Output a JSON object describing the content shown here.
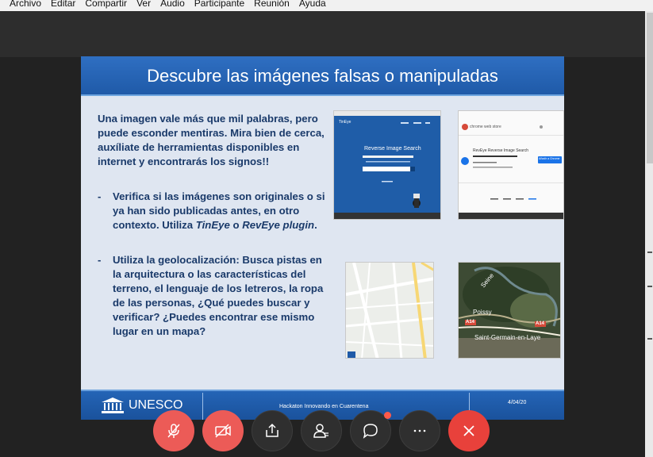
{
  "menu": [
    "Archivo",
    "Editar",
    "Compartir",
    "Ver",
    "Audio",
    "Participante",
    "Reunión",
    "Ayuda"
  ],
  "slide": {
    "title": "Descubre las imágenes falsas o manipuladas",
    "intro": "Una imagen vale más que mil palabras, pero puede esconder mentiras. Mira bien de cerca, auxíliate de herramientas disponibles en internet y encontrarás los signos!!",
    "bullet1_pre": "Verifica si las imágenes son originales o si ya han sido publicadas antes, en otro contexto. Utiliza ",
    "bullet1_tool1": "TinEye",
    "bullet1_mid": " o ",
    "bullet1_tool2": "RevEye plugin",
    "bullet1_post": ".",
    "bullet2": "Utiliza la geolocalización: Busca pistas en la arquitectura o las características del terreno, el lenguaje de los letreros, la ropa de las personas, ¿Qué puedes buscar y verificar? ¿Puedes encontrar ese mismo lugar en un mapa?",
    "dash": "-",
    "thumb_tineye": {
      "logo": "TinEye",
      "heading": "Reverse Image Search"
    },
    "thumb_reveye": {
      "store": "chrome web store",
      "name": "RevEye Reverse Image Search",
      "button": "Añadir a Chrome"
    },
    "thumb_satellite": {
      "label_seine": "Seine",
      "label_poissy": "Poissy",
      "label_city": "Saint-Germain-en-Laye",
      "road1": "A14",
      "road2": "A14"
    },
    "footer": {
      "org": "UNESCO",
      "event": "Hackaton Innovando en Cuarentena",
      "date": "4/04/20"
    }
  },
  "controls": [
    {
      "name": "mute-button",
      "icon": "mic-off-icon"
    },
    {
      "name": "video-button",
      "icon": "video-off-icon"
    },
    {
      "name": "share-button",
      "icon": "share-icon"
    },
    {
      "name": "participants-button",
      "icon": "participants-icon"
    },
    {
      "name": "chat-button",
      "icon": "chat-icon"
    },
    {
      "name": "more-button",
      "icon": "more-icon"
    },
    {
      "name": "leave-button",
      "icon": "close-icon"
    }
  ],
  "colors": {
    "accent_red": "#ec5b57",
    "slide_blue": "#1f5aa8",
    "text_navy": "#1a3a6a"
  }
}
